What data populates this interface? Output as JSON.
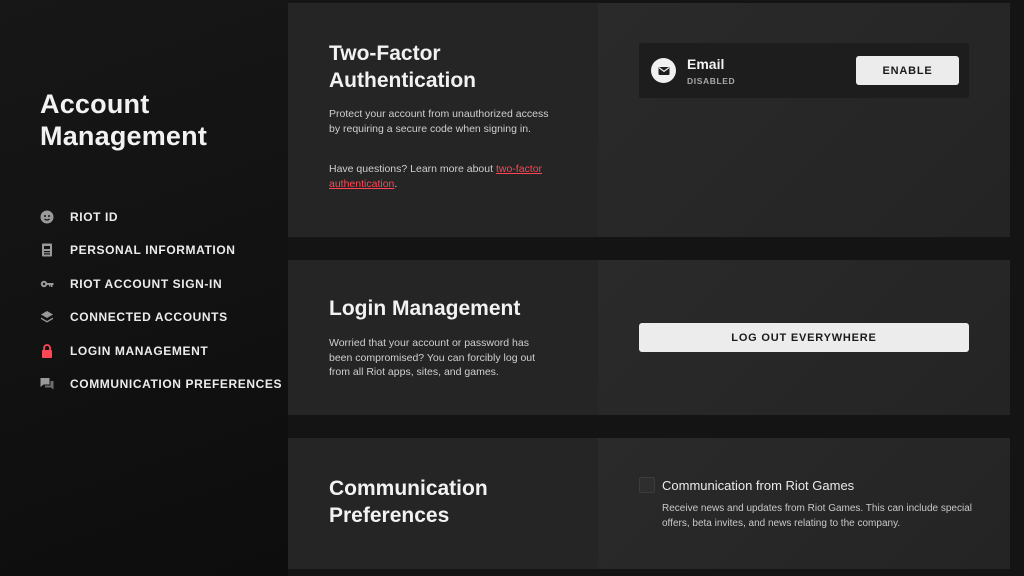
{
  "sidebar": {
    "title": "Account Management",
    "items": [
      {
        "label": "RIOT ID",
        "icon": "face-icon",
        "active": false
      },
      {
        "label": "PERSONAL INFORMATION",
        "icon": "id-card-icon",
        "active": false
      },
      {
        "label": "RIOT ACCOUNT SIGN-IN",
        "icon": "key-icon",
        "active": false
      },
      {
        "label": "CONNECTED ACCOUNTS",
        "icon": "layers-icon",
        "active": false
      },
      {
        "label": "LOGIN MANAGEMENT",
        "icon": "lock-icon",
        "active": true
      },
      {
        "label": "COMMUNICATION PREFERENCES",
        "icon": "chat-icon",
        "active": false
      }
    ]
  },
  "two_factor": {
    "title_line1": "Two-Factor",
    "title_line2": "Authentication",
    "description": "Protect your account from unauthorized access by requiring a secure code when signing in.",
    "questions_prefix": "Have questions? Learn more about ",
    "link_text": "two-factor authentication",
    "questions_suffix": ".",
    "method_label": "Email",
    "method_status": "DISABLED",
    "enable_label": "ENABLE"
  },
  "login_management": {
    "title": "Login Management",
    "description": "Worried that your account or password has been compromised? You can forcibly log out from all Riot apps, sites, and games.",
    "logout_label": "LOG OUT EVERYWHERE"
  },
  "communication": {
    "title_line1": "Communication",
    "title_line2": "Preferences",
    "checkbox_label": "Communication from Riot Games",
    "checkbox_checked": false,
    "checkbox_description": "Receive news and updates from Riot Games. This can include special offers, beta invites, and news relating to the company."
  },
  "colors": {
    "accent": "#ff4655",
    "background": "#141414",
    "card": "#232323",
    "button": "#ececec"
  }
}
